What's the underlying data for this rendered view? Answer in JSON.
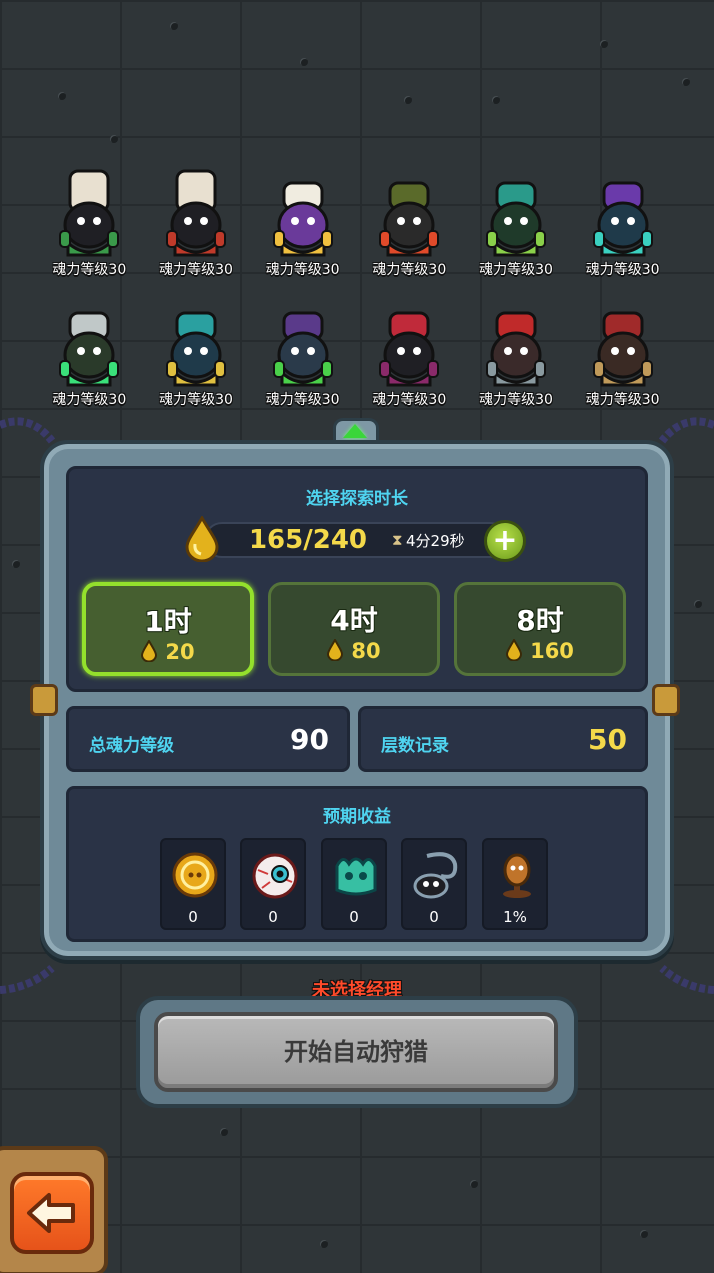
{
  "heroes": [
    {
      "label": "魂力等级30",
      "icon": "chef-hero-icon",
      "hat": "#e8e0d0",
      "body": "#1f1f24",
      "accent": "#3a9a4a"
    },
    {
      "label": "魂力等级30",
      "icon": "chef-hero-icon",
      "hat": "#e8e0d0",
      "body": "#1f1f24",
      "accent": "#c03a2a"
    },
    {
      "label": "魂力等级30",
      "icon": "head-chef-hero-icon",
      "hat": "#f0ece0",
      "body": "#6a3a9a",
      "accent": "#f0c040"
    },
    {
      "label": "魂力等级30",
      "icon": "armored-hero-icon",
      "hat": "#5a6a2a",
      "body": "#2a2a2a",
      "accent": "#e04a2a"
    },
    {
      "label": "魂力等级30",
      "icon": "mech-hero-icon",
      "hat": "#2a9a8a",
      "body": "#1f3a2a",
      "accent": "#8ad04a"
    },
    {
      "label": "魂力等级30",
      "icon": "mage-hero-icon",
      "hat": "#6a3aaa",
      "body": "#1f3a4a",
      "accent": "#3ad0c0"
    },
    {
      "label": "魂力等级30",
      "icon": "scientist-hero-icon",
      "hat": "#c0c8c8",
      "body": "#2a3a2a",
      "accent": "#3ae07a"
    },
    {
      "label": "魂力等级30",
      "icon": "teal-knight-hero-icon",
      "hat": "#2aa0a0",
      "body": "#1f3a4a",
      "accent": "#e0c040"
    },
    {
      "label": "魂力等级30",
      "icon": "horned-hero-icon",
      "hat": "#5a3a8a",
      "body": "#2a3a4a",
      "accent": "#4ad04a"
    },
    {
      "label": "魂力等级30",
      "icon": "pirate-hero-icon",
      "hat": "#c02a3a",
      "body": "#1f1f24",
      "accent": "#8a2a6a"
    },
    {
      "label": "魂力等级30",
      "icon": "samurai-hero-icon",
      "hat": "#c02a2a",
      "body": "#3a2a2a",
      "accent": "#8a9aa0"
    },
    {
      "label": "魂力等级30",
      "icon": "octopus-hero-icon",
      "hat": "#a02a2a",
      "body": "#3a2a24",
      "accent": "#c09a5a"
    }
  ],
  "panel": {
    "title": "选择探索时长",
    "resource": "165/240",
    "timer": "4分29秒",
    "plus_label": "+",
    "durations": [
      {
        "label": "1时",
        "cost": "20",
        "selected": true
      },
      {
        "label": "4时",
        "cost": "80",
        "selected": false
      },
      {
        "label": "8时",
        "cost": "160",
        "selected": false
      }
    ],
    "total_power_label": "总魂力等级",
    "total_power_value": "90",
    "floor_record_label": "层数记录",
    "floor_record_value": "50",
    "rewards_title": "预期收益",
    "rewards": [
      {
        "icon": "gold-coin-icon",
        "count": "0"
      },
      {
        "icon": "eyeball-icon",
        "count": "0"
      },
      {
        "icon": "slime-creature-icon",
        "count": "0"
      },
      {
        "icon": "ghost-lantern-icon",
        "count": "0"
      },
      {
        "icon": "figurine-icon",
        "count": "1%"
      }
    ]
  },
  "warning": "未选择经理",
  "start_button": "开始自动狩猎",
  "colors": {
    "accent_cyan": "#4fd4f0",
    "gold": "#f4d94a",
    "selected_green": "#94e02c",
    "warning_red": "#ff4a2a"
  }
}
